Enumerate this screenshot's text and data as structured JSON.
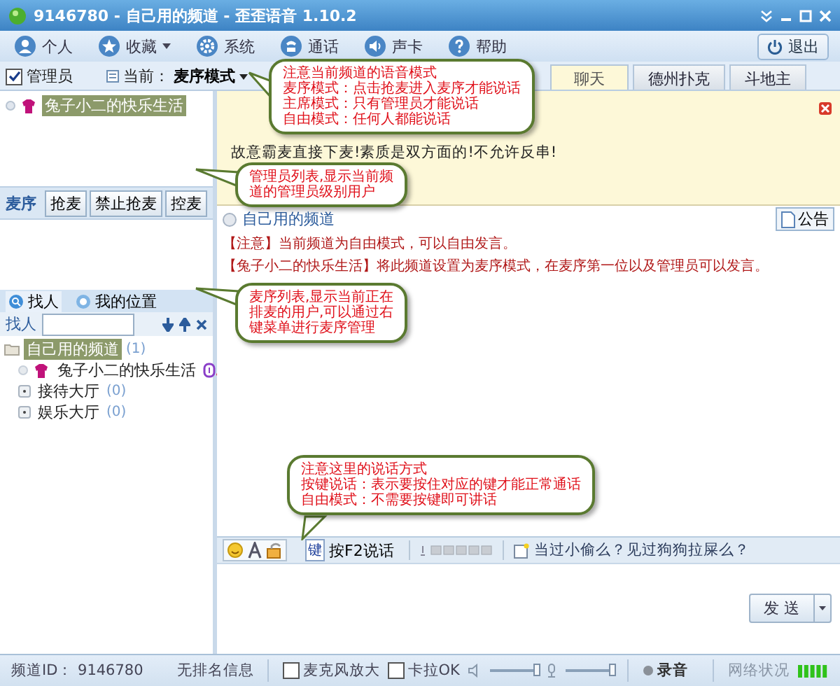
{
  "window": {
    "title": "9146780 - 自己用的频道 - 歪歪语音 1.10.2"
  },
  "toolbar": {
    "items": [
      {
        "kind": "person",
        "label": "个人",
        "dropdown": false
      },
      {
        "kind": "star",
        "label": "收藏",
        "dropdown": true
      },
      {
        "kind": "gear",
        "label": "系统",
        "dropdown": false
      },
      {
        "kind": "phone",
        "label": "通话",
        "dropdown": false
      },
      {
        "kind": "sound",
        "label": "声卡",
        "dropdown": false
      },
      {
        "kind": "help",
        "label": "帮助",
        "dropdown": false
      }
    ],
    "exit": "退出"
  },
  "mode_bar": {
    "admin_checkbox": {
      "label": "管理员",
      "checked": true
    },
    "current_label": "当前：",
    "mode": "麦序模式"
  },
  "tabs": [
    {
      "label": "聊天",
      "selected": true
    },
    {
      "label": "德州扑克",
      "selected": false
    },
    {
      "label": "斗地主",
      "selected": false
    }
  ],
  "admin_list": [
    {
      "name": "兔子小二的快乐生活",
      "selected": true
    }
  ],
  "mic_queue": {
    "title": "麦序",
    "buttons": [
      "抢麦",
      "禁止抢麦",
      "控麦"
    ]
  },
  "finder": {
    "tabs": [
      {
        "label": "找人",
        "selected": true
      },
      {
        "label": "我的位置",
        "selected": false
      }
    ],
    "search_label": "找人"
  },
  "channel_tree": [
    {
      "kind": "channel",
      "name": "自己用的频道",
      "count": "(1)",
      "selected": true,
      "children": [
        {
          "kind": "user",
          "name": "兔子小二的快乐生活",
          "selected": false
        },
        {
          "kind": "room",
          "name": "接待大厅",
          "count": "(0)",
          "selected": false
        },
        {
          "kind": "room",
          "name": "娱乐大厅",
          "count": "(0)",
          "selected": false
        }
      ]
    }
  ],
  "notice": {
    "lines": [
      "故意霸麦直接下麦!素质是双方面的!不允许反串!"
    ]
  },
  "chat": {
    "channel": "自己用的频道",
    "announce_button": "公告",
    "messages": [
      "【注意】当前频道为自由模式，可以自由发言。",
      "【兔子小二的快乐生活】将此频道设置为麦序模式，在麦序第一位以及管理员可以发言。"
    ]
  },
  "input_bar": {
    "talk_key": "键",
    "talk_label": "按F2说话",
    "tip": "当过小偷么？见过狗狗拉屎么？"
  },
  "send_button": "发 送",
  "status_bar": {
    "channel_id": "频道ID： 9146780",
    "rank": "无排名信息",
    "checks": [
      {
        "label": "麦克风放大",
        "checked": false
      },
      {
        "label": "卡拉OK",
        "checked": false
      }
    ],
    "speaker": {
      "level": 1
    },
    "mic": {
      "level": 1
    },
    "record": "录音",
    "network_label": "网络状况"
  },
  "callouts": [
    {
      "lines": [
        "注意当前频道的语音模式",
        "麦序模式：点击抢麦进入麦序才能说话",
        "主席模式：只有管理员才能说话",
        "自由模式：任何人都能说话"
      ]
    },
    {
      "lines": [
        "管理员列表,显示当前频",
        "道的管理员级别用户"
      ]
    },
    {
      "lines": [
        "麦序列表,显示当前正在",
        "排麦的用户,可以通过右",
        "键菜单进行麦序管理"
      ]
    },
    {
      "lines": [
        "注意这里的说话方式",
        "按键说话：表示要按住对应的键才能正常通话",
        "自由模式：不需要按键即可讲话"
      ]
    }
  ]
}
